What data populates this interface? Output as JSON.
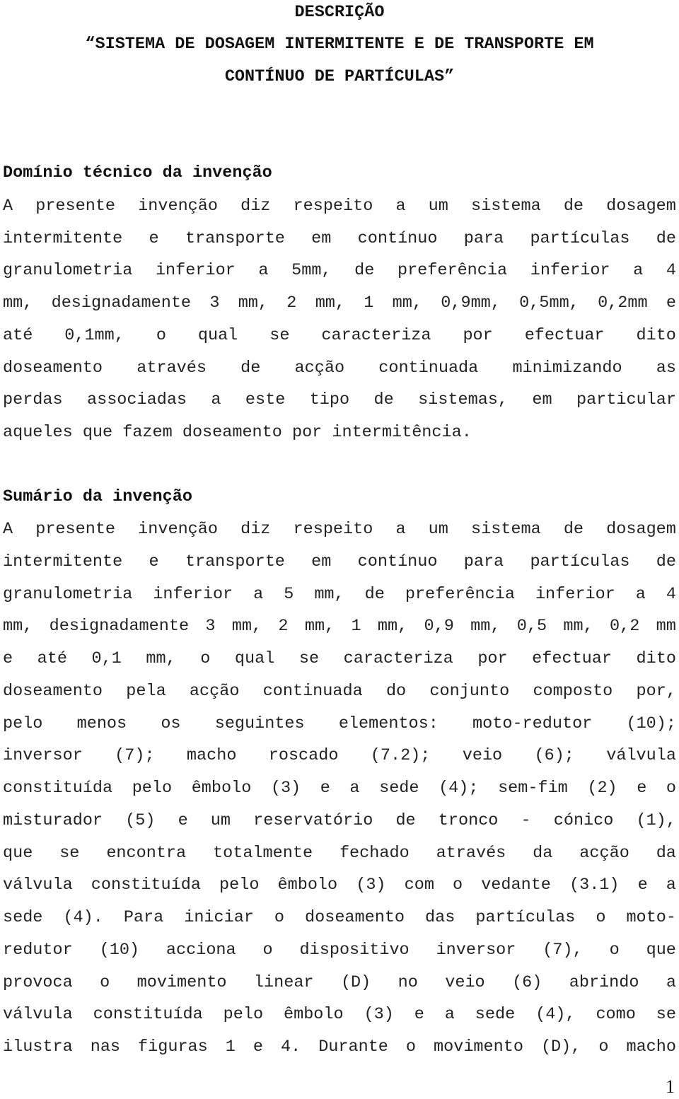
{
  "document": {
    "label": "DESCRIÇÃO",
    "title_lines": [
      "“SISTEMA DE DOSAGEM INTERMITENTE E DE TRANSPORTE EM",
      "CONTÍNUO DE PARTÍCULAS”"
    ],
    "sections": [
      {
        "heading": "Domínio técnico da invenção",
        "lines": [
          "A presente invenção diz respeito a um sistema de dosagem",
          "intermitente e transporte em contínuo para partículas de",
          "granulometria inferior a 5mm, de preferência inferior a 4",
          "mm, designadamente 3 mm, 2 mm, 1 mm, 0,9mm, 0,5mm, 0,2mm e",
          "até 0,1mm, o qual se caracteriza por efectuar dito",
          "doseamento através de acção continuada minimizando as",
          "perdas associadas a este tipo de sistemas, em particular",
          "aqueles que fazem doseamento por intermitência."
        ]
      },
      {
        "heading": "Sumário da invenção",
        "lines": [
          "A presente invenção diz respeito a um sistema de dosagem",
          "intermitente e transporte em contínuo para partículas de",
          "granulometria inferior a 5 mm, de preferência inferior a 4",
          "mm, designadamente 3 mm, 2 mm, 1 mm, 0,9 mm, 0,5 mm, 0,2 mm",
          "e até 0,1 mm, o qual se caracteriza por efectuar dito",
          "doseamento pela acção continuada do conjunto composto por,",
          "pelo menos os seguintes elementos: moto-redutor (10);",
          "inversor (7); macho roscado (7.2); veio (6); válvula",
          "constituída pelo êmbolo (3) e a sede (4); sem-fim (2) e o",
          "misturador (5) e um reservatório de tronco - cónico (1),",
          "que se encontra totalmente fechado através da acção da",
          "válvula constituída pelo êmbolo (3) com o vedante (3.1) e a",
          "sede (4). Para iniciar o doseamento das partículas o moto-",
          "redutor (10) acciona o dispositivo inversor (7), o que",
          "provoca o movimento linear (D) no veio (6) abrindo a",
          "válvula constituída pelo êmbolo (3) e a sede (4), como se",
          "ilustra nas figuras 1 e 4. Durante o movimento (D), o macho"
        ]
      }
    ],
    "page_number": "1"
  }
}
